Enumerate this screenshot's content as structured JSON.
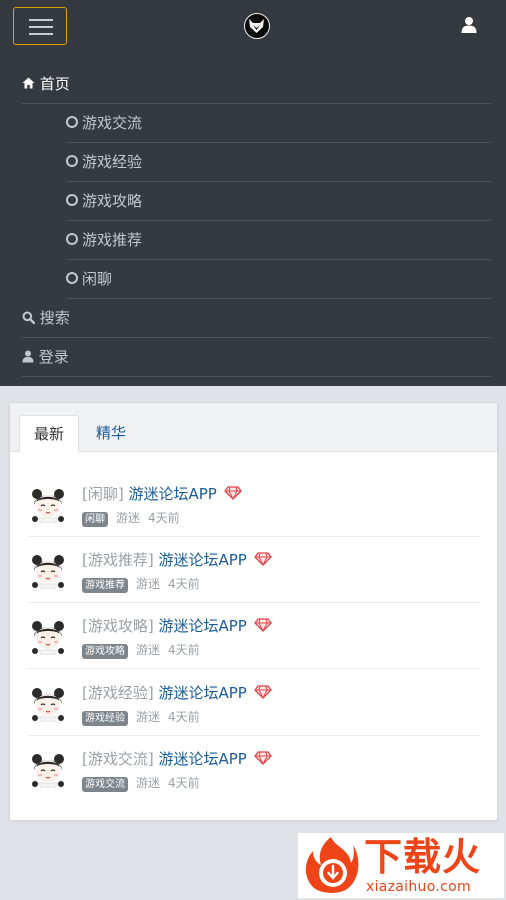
{
  "nav": {
    "home": "首页",
    "sub_items": [
      {
        "label": "游戏交流"
      },
      {
        "label": "游戏经验"
      },
      {
        "label": "游戏攻略"
      },
      {
        "label": "游戏推荐"
      },
      {
        "label": "闲聊"
      }
    ],
    "search": "搜索",
    "login": "登录"
  },
  "tabs": {
    "latest": "最新",
    "featured": "精华"
  },
  "threads": [
    {
      "category": "[闲聊]",
      "title": "游迷论坛APP",
      "badge": "闲聊",
      "author": "游迷",
      "time": "4天前"
    },
    {
      "category": "[游戏推荐]",
      "title": "游迷论坛APP",
      "badge": "游戏推荐",
      "author": "游迷",
      "time": "4天前"
    },
    {
      "category": "[游戏攻略]",
      "title": "游迷论坛APP",
      "badge": "游戏攻略",
      "author": "游迷",
      "time": "4天前"
    },
    {
      "category": "[游戏经验]",
      "title": "游迷论坛APP",
      "badge": "游戏经验",
      "author": "游迷",
      "time": "4天前"
    },
    {
      "category": "[游戏交流]",
      "title": "游迷论坛APP",
      "badge": "游戏交流",
      "author": "游迷",
      "time": "4天前"
    }
  ],
  "watermark": {
    "text": "下载火",
    "url": "xiazaihuo.com"
  },
  "colors": {
    "navbar_bg": "#343a40",
    "link_blue": "#1a5c9e",
    "gem_red": "#e8434a",
    "toggler_border": "#e0a100",
    "watermark_orange": "#ef4418"
  }
}
